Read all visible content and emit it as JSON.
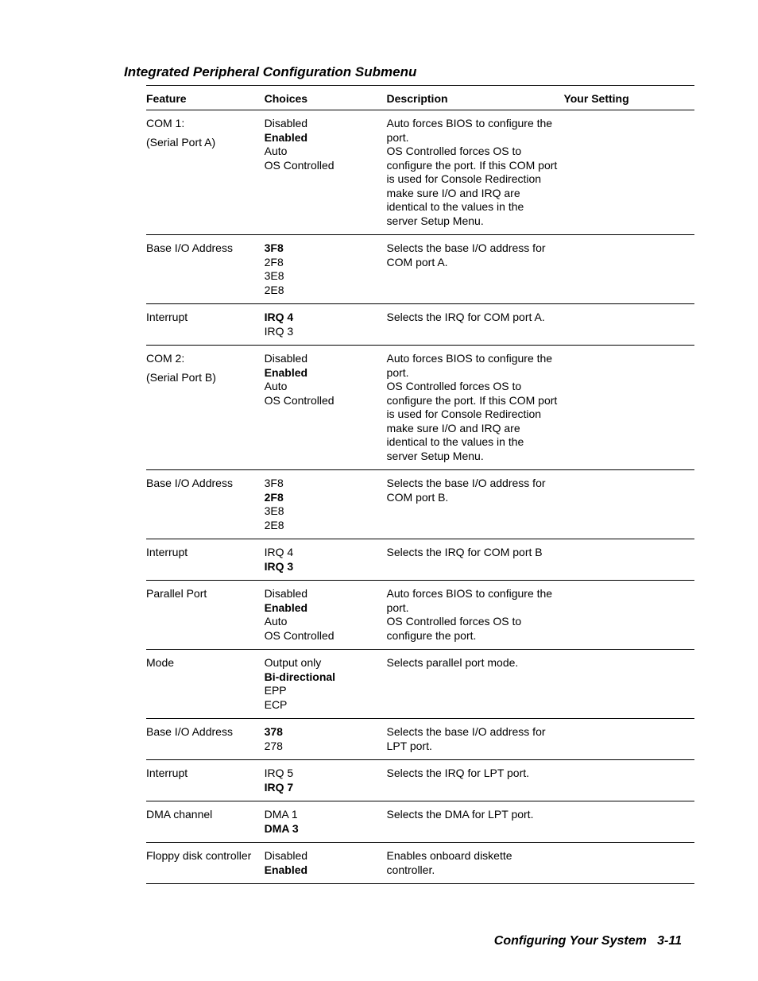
{
  "title": "Integrated Peripheral Configuration Submenu",
  "headers": {
    "c1": "Feature",
    "c2": "Choices",
    "c3": "Description",
    "c4": "Your Setting"
  },
  "footer": {
    "text": "Configuring Your System",
    "page": "3-11"
  },
  "rows": [
    {
      "feature_main": "COM 1:",
      "feature_sub": "(Serial Port A)",
      "choices": [
        {
          "t": "Disabled",
          "b": false
        },
        {
          "t": "Enabled",
          "b": true
        },
        {
          "t": "Auto",
          "b": false
        },
        {
          "t": "OS Controlled",
          "b": false
        }
      ],
      "desc": "Auto forces BIOS to configure the port.\nOS Controlled forces OS to configure the port. If this COM port is used for Console Redirection make sure I/O and IRQ are identical to the values in the server Setup Menu."
    },
    {
      "feature_main": "Base I/O Address",
      "choices": [
        {
          "t": "3F8",
          "b": true
        },
        {
          "t": "2F8",
          "b": false
        },
        {
          "t": "3E8",
          "b": false
        },
        {
          "t": "2E8",
          "b": false
        }
      ],
      "desc": "Selects the base I/O address for COM port A."
    },
    {
      "feature_main": "Interrupt",
      "choices": [
        {
          "t": "IRQ 4",
          "b": true
        },
        {
          "t": "IRQ 3",
          "b": false
        }
      ],
      "desc": "Selects the IRQ for COM port A."
    },
    {
      "feature_main": "COM 2:",
      "feature_sub": "(Serial Port B)",
      "choices": [
        {
          "t": "Disabled",
          "b": false
        },
        {
          "t": "Enabled",
          "b": true
        },
        {
          "t": "Auto",
          "b": false
        },
        {
          "t": "OS Controlled",
          "b": false
        }
      ],
      "desc": "Auto forces BIOS to configure the port.\nOS Controlled forces OS to configure the port. If this COM port is used for Console Redirection make sure I/O and IRQ are identical to the values in the server Setup Menu."
    },
    {
      "feature_main": "Base I/O Address",
      "choices": [
        {
          "t": "3F8",
          "b": false
        },
        {
          "t": "2F8",
          "b": true
        },
        {
          "t": "3E8",
          "b": false
        },
        {
          "t": "2E8",
          "b": false
        }
      ],
      "desc": "Selects the base I/O address for COM port B."
    },
    {
      "feature_main": "Interrupt",
      "choices": [
        {
          "t": "IRQ 4",
          "b": false
        },
        {
          "t": "IRQ 3",
          "b": true
        }
      ],
      "desc": "Selects the IRQ for COM port B"
    },
    {
      "feature_main": "Parallel Port",
      "choices": [
        {
          "t": "Disabled",
          "b": false
        },
        {
          "t": "Enabled",
          "b": true
        },
        {
          "t": "Auto",
          "b": false
        },
        {
          "t": "OS Controlled",
          "b": false
        }
      ],
      "desc": "Auto forces BIOS to configure the port.\nOS Controlled forces OS to configure the port."
    },
    {
      "feature_main": "Mode",
      "choices": [
        {
          "t": "Output only",
          "b": false
        },
        {
          "t": "Bi-directional",
          "b": true
        },
        {
          "t": "EPP",
          "b": false
        },
        {
          "t": "ECP",
          "b": false
        }
      ],
      "desc": "Selects parallel port mode."
    },
    {
      "feature_main": "Base I/O Address",
      "choices": [
        {
          "t": "378",
          "b": true
        },
        {
          "t": "278",
          "b": false
        }
      ],
      "desc": "Selects the base I/O address for LPT port."
    },
    {
      "feature_main": "Interrupt",
      "choices": [
        {
          "t": "IRQ 5",
          "b": false
        },
        {
          "t": "IRQ 7",
          "b": true
        }
      ],
      "desc": "Selects the IRQ for LPT port."
    },
    {
      "feature_main": "DMA channel",
      "choices": [
        {
          "t": "DMA 1",
          "b": false
        },
        {
          "t": "DMA 3",
          "b": true
        }
      ],
      "desc": "Selects the DMA for LPT port."
    },
    {
      "feature_main": "Floppy disk controller",
      "choices": [
        {
          "t": "Disabled",
          "b": false
        },
        {
          "t": "Enabled",
          "b": true
        }
      ],
      "desc": "Enables onboard diskette controller."
    }
  ]
}
